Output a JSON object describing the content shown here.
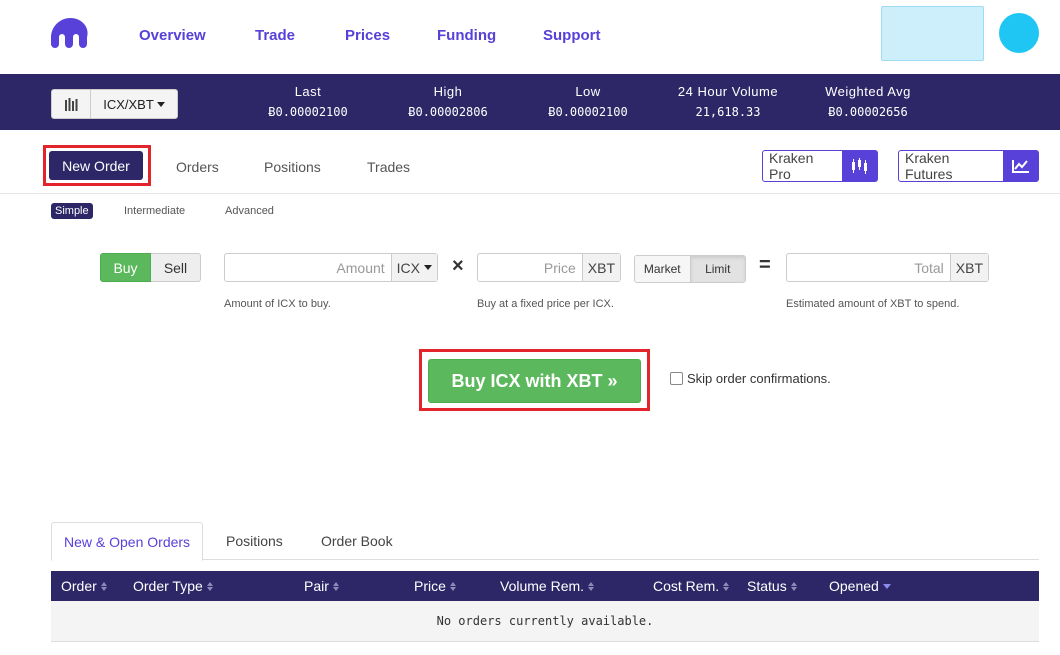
{
  "nav": {
    "links": [
      "Overview",
      "Trade",
      "Prices",
      "Funding",
      "Support"
    ]
  },
  "ticker": {
    "pair": "ICX/XBT",
    "stats": [
      {
        "label": "Last",
        "value": "Ƀ0.00002100"
      },
      {
        "label": "High",
        "value": "Ƀ0.00002806"
      },
      {
        "label": "Low",
        "value": "Ƀ0.00002100"
      },
      {
        "label": "24 Hour Volume",
        "value": "21,618.33"
      },
      {
        "label": "Weighted Avg",
        "value": "Ƀ0.00002656"
      }
    ]
  },
  "order_tabs": {
    "new_order": "New Order",
    "orders": "Orders",
    "positions": "Positions",
    "trades": "Trades",
    "kraken_pro": "Kraken Pro",
    "kraken_futures": "Kraken Futures"
  },
  "levels": {
    "simple": "Simple",
    "intermediate": "Intermediate",
    "advanced": "Advanced"
  },
  "form": {
    "buy": "Buy",
    "sell": "Sell",
    "amount_placeholder": "Amount",
    "amount_currency": "ICX",
    "times": "×",
    "price_placeholder": "Price",
    "price_currency": "XBT",
    "market": "Market",
    "limit": "Limit",
    "equals": "=",
    "total_placeholder": "Total",
    "total_currency": "XBT",
    "amount_help": "Amount of ICX to buy.",
    "price_help": "Buy at a fixed price per ICX.",
    "total_help": "Estimated amount of XBT to spend.",
    "submit": "Buy ICX with XBT »",
    "skip_confirm": "Skip order confirmations."
  },
  "bottom_tabs": [
    "New & Open Orders",
    "Positions",
    "Order Book"
  ],
  "table": {
    "columns": [
      "Order",
      "Order Type",
      "Pair",
      "Price",
      "Volume Rem.",
      "Cost Rem.",
      "Status",
      "Opened"
    ],
    "empty_message": "No orders currently available."
  },
  "colors": {
    "brand_purple": "#5741d9",
    "dark_navy": "#2d2767",
    "buy_green": "#5cb85c",
    "highlight_red": "#e3242b"
  }
}
